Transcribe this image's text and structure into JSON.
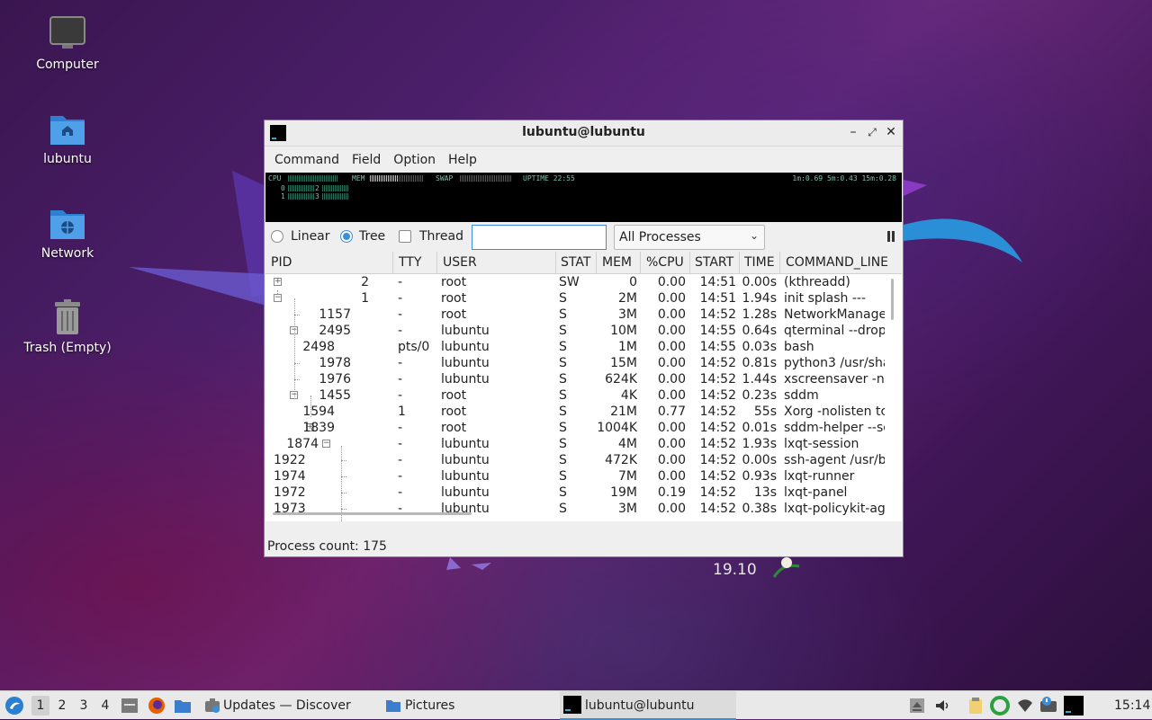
{
  "desktop": {
    "icons": [
      {
        "label": "Computer",
        "icon": "computer-icon"
      },
      {
        "label": "lubuntu",
        "icon": "home-folder-icon"
      },
      {
        "label": "Network",
        "icon": "network-folder-icon"
      },
      {
        "label": "Trash (Empty)",
        "icon": "trash-icon"
      }
    ],
    "version_label": "19.10"
  },
  "window": {
    "title": "lubuntu@lubuntu",
    "menu": [
      "Command",
      "Field",
      "Option",
      "Help"
    ],
    "monitor": {
      "cpu_label": "CPU",
      "mem_label": "MEM",
      "swap_label": "SWAP",
      "uptime": "UPTIME 22:55",
      "loadavg": "1m:0.69 5m:0.43 15m:0.28",
      "cpu_core_labels": [
        "0",
        "1",
        "2",
        "3"
      ]
    },
    "filters": {
      "linear_label": "Linear",
      "tree_label": "Tree",
      "thread_label": "Thread",
      "selected_mode": "Tree",
      "search_value": "",
      "process_filter": "All Processes"
    },
    "columns": [
      "PID",
      "TTY",
      "USER",
      "STAT",
      "MEM",
      "%CPU",
      "START",
      "TIME",
      "COMMAND_LINE"
    ],
    "rows": [
      {
        "pid": "2",
        "tty": "-",
        "user": "root",
        "stat": "SW",
        "mem": "0",
        "cpu": "0.00",
        "start": "14:51",
        "time": "0.00s",
        "cmd": "(kthreadd)"
      },
      {
        "pid": "1",
        "tty": "-",
        "user": "root",
        "stat": "S",
        "mem": "2M",
        "cpu": "0.00",
        "start": "14:51",
        "time": "1.94s",
        "cmd": "init splash ---"
      },
      {
        "pid": "1157",
        "tty": "-",
        "user": "root",
        "stat": "S",
        "mem": "3M",
        "cpu": "0.00",
        "start": "14:52",
        "time": "1.28s",
        "cmd": "NetworkManager"
      },
      {
        "pid": "2495",
        "tty": "-",
        "user": "lubuntu",
        "stat": "S",
        "mem": "10M",
        "cpu": "0.00",
        "start": "14:55",
        "time": "0.64s",
        "cmd": "qterminal --drop"
      },
      {
        "pid": "2498",
        "tty": "pts/0",
        "user": "lubuntu",
        "stat": "S",
        "mem": "1M",
        "cpu": "0.00",
        "start": "14:55",
        "time": "0.03s",
        "cmd": "bash"
      },
      {
        "pid": "1978",
        "tty": "-",
        "user": "lubuntu",
        "stat": "S",
        "mem": "15M",
        "cpu": "0.00",
        "start": "14:52",
        "time": "0.81s",
        "cmd": "python3 /usr/sha"
      },
      {
        "pid": "1976",
        "tty": "-",
        "user": "lubuntu",
        "stat": "S",
        "mem": "624K",
        "cpu": "0.00",
        "start": "14:52",
        "time": "1.44s",
        "cmd": "xscreensaver -no"
      },
      {
        "pid": "1455",
        "tty": "-",
        "user": "root",
        "stat": "S",
        "mem": "4K",
        "cpu": "0.00",
        "start": "14:52",
        "time": "0.23s",
        "cmd": "sddm"
      },
      {
        "pid": "1594",
        "tty": "1",
        "user": "root",
        "stat": "S",
        "mem": "21M",
        "cpu": "0.77",
        "start": "14:52",
        "time": "55s",
        "cmd": "Xorg -nolisten tc"
      },
      {
        "pid": "1839",
        "tty": "-",
        "user": "root",
        "stat": "S",
        "mem": "1004K",
        "cpu": "0.00",
        "start": "14:52",
        "time": "0.01s",
        "cmd": "sddm-helper --sc"
      },
      {
        "pid": "1874",
        "tty": "-",
        "user": "lubuntu",
        "stat": "S",
        "mem": "4M",
        "cpu": "0.00",
        "start": "14:52",
        "time": "1.93s",
        "cmd": "lxqt-session"
      },
      {
        "pid": "1922",
        "tty": "-",
        "user": "lubuntu",
        "stat": "S",
        "mem": "472K",
        "cpu": "0.00",
        "start": "14:52",
        "time": "0.00s",
        "cmd": "ssh-agent /usr/b"
      },
      {
        "pid": "1974",
        "tty": "-",
        "user": "lubuntu",
        "stat": "S",
        "mem": "7M",
        "cpu": "0.00",
        "start": "14:52",
        "time": "0.93s",
        "cmd": "lxqt-runner"
      },
      {
        "pid": "1972",
        "tty": "-",
        "user": "lubuntu",
        "stat": "S",
        "mem": "19M",
        "cpu": "0.19",
        "start": "14:52",
        "time": "13s",
        "cmd": "lxqt-panel"
      },
      {
        "pid": "1973",
        "tty": "-",
        "user": "lubuntu",
        "stat": "S",
        "mem": "3M",
        "cpu": "0.00",
        "start": "14:52",
        "time": "0.38s",
        "cmd": "lxqt-policykit-age"
      }
    ],
    "status": "Process count: 175"
  },
  "taskbar": {
    "workspaces": [
      "1",
      "2",
      "3",
      "4"
    ],
    "active_workspace": "1",
    "tasks": [
      {
        "label": "Updates — Discover",
        "icon": "discover-icon"
      },
      {
        "label": "Pictures",
        "icon": "folder-icon"
      },
      {
        "label": "lubuntu@lubuntu",
        "icon": "terminal-icon",
        "active": true
      }
    ],
    "clock": "15:14"
  },
  "colors": {
    "accent": "#3b8ed8",
    "monitor_text": "#7fbfa7"
  }
}
